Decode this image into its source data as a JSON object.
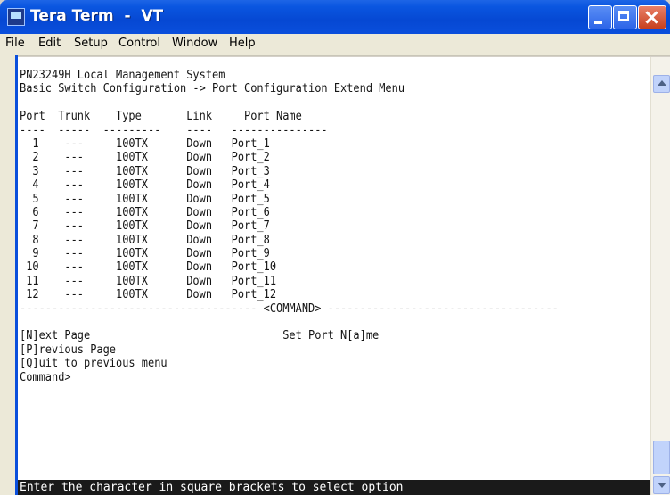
{
  "window": {
    "title": "Tera Term  -  VT"
  },
  "colors": {
    "titlebar": "#0a4fdc",
    "terminal_bg": "#ffffff",
    "terminal_fg": "#141414",
    "status_bg": "#1a1a1a"
  },
  "menu": {
    "items": [
      {
        "label": "File"
      },
      {
        "label": "Edit"
      },
      {
        "label": "Setup"
      },
      {
        "label": "Control"
      },
      {
        "label": "Window"
      },
      {
        "label": "Help"
      }
    ]
  },
  "terminal": {
    "lines": [
      "PN23249H Local Management System",
      "Basic Switch Configuration -> Port Configuration Extend Menu",
      "",
      "Port  Trunk    Type       Link     Port Name",
      "----  -----  ---------    ----   ---------------",
      "  1    ---     100TX      Down   Port_1",
      "  2    ---     100TX      Down   Port_2",
      "  3    ---     100TX      Down   Port_3",
      "  4    ---     100TX      Down   Port_4",
      "  5    ---     100TX      Down   Port_5",
      "  6    ---     100TX      Down   Port_6",
      "  7    ---     100TX      Down   Port_7",
      "  8    ---     100TX      Down   Port_8",
      "  9    ---     100TX      Down   Port_9",
      " 10    ---     100TX      Down   Port_10",
      " 11    ---     100TX      Down   Port_11",
      " 12    ---     100TX      Down   Port_12",
      "------------------------------------- <COMMAND> ------------------------------------",
      "",
      "[N]ext Page                              Set Port N[a]me",
      "[P]revious Page",
      "[Q]uit to previous menu",
      "Command>"
    ],
    "status_line": "Enter the character in square brackets to select option"
  }
}
